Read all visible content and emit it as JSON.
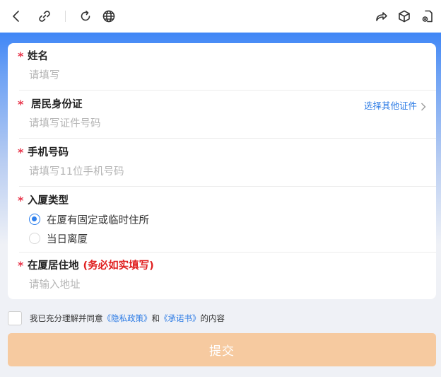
{
  "toolbar": {
    "back_icon": "chevron-left-icon",
    "link_icon": "link-icon",
    "refresh_icon": "refresh-icon",
    "globe_icon": "globe-icon",
    "share_icon": "share-icon",
    "cube_icon": "cube-icon",
    "doc_icon": "document-settings-icon"
  },
  "form": {
    "name": {
      "required": "*",
      "label": "姓名",
      "placeholder": "请填写"
    },
    "id_card": {
      "required": "*",
      "label": "居民身份证",
      "placeholder": "请填写证件号码",
      "alt_link": "选择其他证件"
    },
    "phone": {
      "required": "*",
      "label": "手机号码",
      "placeholder": "请填写11位手机号码"
    },
    "entry_type": {
      "required": "*",
      "label": "入厦类型",
      "options": [
        {
          "label": "在厦有固定或临时住所",
          "selected": true
        },
        {
          "label": "当日离厦",
          "selected": false
        }
      ]
    },
    "address": {
      "required": "*",
      "label": "在厦居住地",
      "warning": "(务必如实填写)",
      "placeholder": "请输入地址"
    }
  },
  "agreement": {
    "checked": false,
    "prefix": "我已充分理解并同意",
    "privacy_link": "《隐私政策》",
    "middle": "和",
    "promise_link": "《承诺书》",
    "suffix": "的内容"
  },
  "submit_label": "提交",
  "colors": {
    "accent": "#2f80ed",
    "required": "#e8364b",
    "warning": "#e02020",
    "submit_disabled": "#f6caa0",
    "header_blue": "#3f86f6"
  }
}
